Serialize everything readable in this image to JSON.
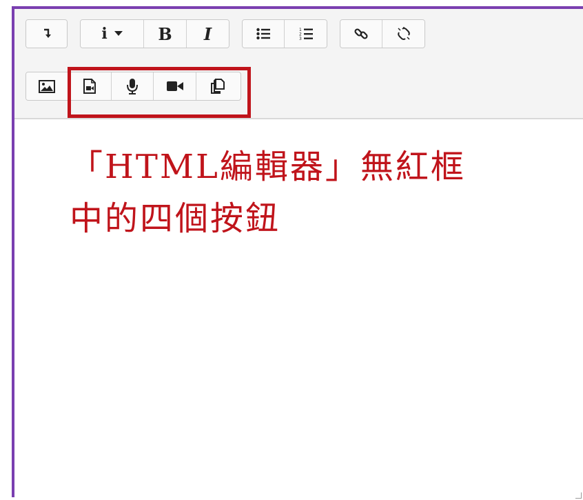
{
  "toolbar": {
    "row1": {
      "toggle_icon": "arrow-down-icon",
      "style_button": {
        "label": "i",
        "icon": "caret-down-icon"
      },
      "bold_label": "B",
      "italic_label": "I",
      "unordered_list_icon": "list-ul-icon",
      "ordered_list_icon": "list-ol-icon",
      "link_icon": "link-icon",
      "unlink_icon": "unlink-icon"
    },
    "row2": {
      "image_icon": "image-icon",
      "media_icon": "file-video-icon",
      "record_audio_icon": "microphone-icon",
      "record_video_icon": "video-camera-icon",
      "manage_files_icon": "copy-files-icon"
    },
    "highlight_color": "#c0141b",
    "frame_color": "#7a3fb0"
  },
  "editor": {
    "annotation_line1": "「HTML編輯器」無紅框",
    "annotation_line2": "中的四個按鈕",
    "annotation_color": "#c0141b"
  }
}
